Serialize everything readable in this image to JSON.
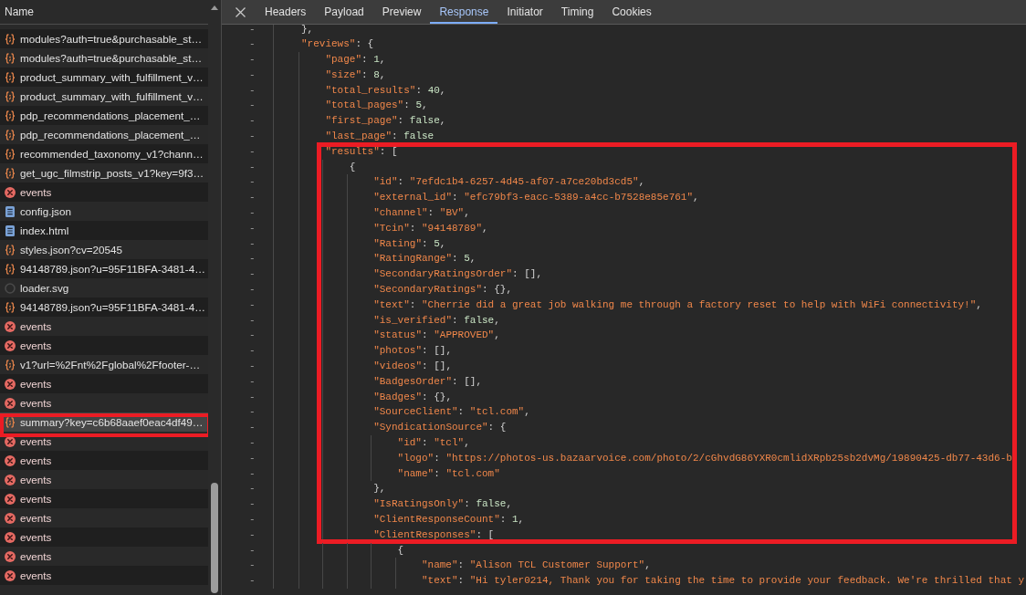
{
  "network_list": {
    "column": "Name",
    "requests": [
      {
        "name": "modules?auth=true&purchasable_st…",
        "kind": "fetch",
        "selected": false
      },
      {
        "name": "modules?auth=true&purchasable_st…",
        "kind": "fetch",
        "selected": false
      },
      {
        "name": "product_summary_with_fulfillment_v…",
        "kind": "fetch",
        "selected": false
      },
      {
        "name": "product_summary_with_fulfillment_v…",
        "kind": "fetch",
        "selected": false
      },
      {
        "name": "pdp_recommendations_placement_…",
        "kind": "fetch",
        "selected": false
      },
      {
        "name": "pdp_recommendations_placement_…",
        "kind": "fetch",
        "selected": false
      },
      {
        "name": "recommended_taxonomy_v1?chann…",
        "kind": "fetch",
        "selected": false
      },
      {
        "name": "get_ugc_filmstrip_posts_v1?key=9f3…",
        "kind": "fetch",
        "selected": false
      },
      {
        "name": "events",
        "kind": "error",
        "selected": false
      },
      {
        "name": "config.json",
        "kind": "document",
        "selected": false
      },
      {
        "name": "index.html",
        "kind": "document",
        "selected": false
      },
      {
        "name": "styles.json?cv=20545",
        "kind": "fetch",
        "selected": false
      },
      {
        "name": "94148789.json?u=95F11BFA-3481-4…",
        "kind": "fetch",
        "selected": false
      },
      {
        "name": "loader.svg",
        "kind": "image",
        "selected": false
      },
      {
        "name": "94148789.json?u=95F11BFA-3481-4…",
        "kind": "fetch",
        "selected": false
      },
      {
        "name": "events",
        "kind": "error",
        "selected": false
      },
      {
        "name": "events",
        "kind": "error",
        "selected": false
      },
      {
        "name": "v1?url=%2Fnt%2Fglobal%2Ffooter-…",
        "kind": "fetch",
        "selected": false
      },
      {
        "name": "events",
        "kind": "error",
        "selected": false
      },
      {
        "name": "events",
        "kind": "error",
        "selected": false
      },
      {
        "name": "summary?key=c6b68aaef0eac4df49…",
        "kind": "fetch",
        "selected": true,
        "framed": true
      },
      {
        "name": "events",
        "kind": "error",
        "selected": false
      },
      {
        "name": "events",
        "kind": "error",
        "selected": false
      },
      {
        "name": "events",
        "kind": "error",
        "selected": false
      },
      {
        "name": "events",
        "kind": "error",
        "selected": false
      },
      {
        "name": "events",
        "kind": "error",
        "selected": false
      },
      {
        "name": "events",
        "kind": "error",
        "selected": false
      },
      {
        "name": "events",
        "kind": "error",
        "selected": false
      },
      {
        "name": "events",
        "kind": "error",
        "selected": false
      }
    ]
  },
  "details": {
    "tabs": [
      {
        "label": "Headers",
        "selected": false
      },
      {
        "label": "Payload",
        "selected": false
      },
      {
        "label": "Preview",
        "selected": false
      },
      {
        "label": "Response",
        "selected": true
      },
      {
        "label": "Initiator",
        "selected": false
      },
      {
        "label": "Timing",
        "selected": false
      },
      {
        "label": "Cookies",
        "selected": false
      }
    ],
    "response": {
      "lines": [
        {
          "gutter": "-",
          "text": "},"
        },
        {
          "gutter": "-",
          "text": "\"reviews\": {",
          "children": [
            {
              "gutter": "-",
              "text": "\"page\": 1,"
            },
            {
              "gutter": "-",
              "text": "\"size\": 8,"
            },
            {
              "gutter": "-",
              "text": "\"total_results\": 40,"
            },
            {
              "gutter": "-",
              "text": "\"total_pages\": 5,"
            },
            {
              "gutter": "-",
              "text": "\"first_page\": false,"
            },
            {
              "gutter": "-",
              "text": "\"last_page\": false"
            },
            {
              "gutter": "-",
              "text": "\"results\": [",
              "framed": true,
              "children": [
                {
                  "gutter": "-",
                  "text": "{",
                  "framed": true,
                  "children": [
                    {
                      "gutter": "-",
                      "text": "\"id\": \"7efdc1b4-6257-4d45-af07-a7ce20bd3cd5\",",
                      "framed": true
                    },
                    {
                      "gutter": "-",
                      "text": "\"external_id\": \"efc79bf3-eacc-5389-a4cc-b7528e85e761\",",
                      "framed": true
                    },
                    {
                      "gutter": "-",
                      "text": "\"channel\": \"BV\",",
                      "framed": true
                    },
                    {
                      "gutter": "-",
                      "text": "\"Tcin\": \"94148789\",",
                      "framed": true
                    },
                    {
                      "gutter": "-",
                      "text": "\"Rating\": 5,",
                      "framed": true
                    },
                    {
                      "gutter": "-",
                      "text": "\"RatingRange\": 5,",
                      "framed": true
                    },
                    {
                      "gutter": "-",
                      "text": "\"SecondaryRatingsOrder\": [],",
                      "framed": true
                    },
                    {
                      "gutter": "-",
                      "text": "\"SecondaryRatings\": {},",
                      "framed": true
                    },
                    {
                      "gutter": "-",
                      "text": "\"text\": \"Cherrie did a great job walking me through a factory reset to help with WiFi connectivity!\",",
                      "framed": true
                    },
                    {
                      "gutter": "-",
                      "text": "\"is_verified\": false,",
                      "framed": true
                    },
                    {
                      "gutter": "-",
                      "text": "\"status\": \"APPROVED\",",
                      "framed": true
                    },
                    {
                      "gutter": "-",
                      "text": "\"photos\": [],",
                      "framed": true
                    },
                    {
                      "gutter": "-",
                      "text": "\"videos\": [],",
                      "framed": true
                    },
                    {
                      "gutter": "-",
                      "text": "\"BadgesOrder\": [],",
                      "framed": true
                    },
                    {
                      "gutter": "-",
                      "text": "\"Badges\": {},",
                      "framed": true
                    },
                    {
                      "gutter": "-",
                      "text": "\"SourceClient\": \"tcl.com\",",
                      "framed": true
                    },
                    {
                      "gutter": "-",
                      "text": "\"SyndicationSource\": {",
                      "framed": true,
                      "children": [
                        {
                          "gutter": "-",
                          "text": "\"id\": \"tcl\",",
                          "framed": true
                        },
                        {
                          "gutter": "-",
                          "text": "\"logo\": \"https://photos-us.bazaarvoice.com/photo/2/cGhvdG86YXR0cmlidXRpb25sb2dvMg/19890425-db77-43d6-b",
                          "framed": true
                        },
                        {
                          "gutter": "-",
                          "text": "\"name\": \"tcl.com\"",
                          "framed": true
                        }
                      ]
                    },
                    {
                      "gutter": "-",
                      "text": "},",
                      "framed": true
                    },
                    {
                      "gutter": "-",
                      "text": "\"IsRatingsOnly\": false,",
                      "framed": true
                    },
                    {
                      "gutter": "-",
                      "text": "\"ClientResponseCount\": 1,",
                      "framed": true
                    },
                    {
                      "gutter": "-",
                      "text": "\"ClientResponses\": [",
                      "framed": true,
                      "children": [
                        {
                          "gutter": "-",
                          "text": "{",
                          "children": [
                            {
                              "gutter": "-",
                              "text": "\"name\": \"Alison TCL Customer Support\","
                            },
                            {
                              "gutter": "-",
                              "text": "\"text\": \"Hi tyler0214, Thank you for taking the time to provide your feedback. We're thrilled that y"
                            }
                          ]
                        }
                      ]
                    }
                  ]
                }
              ]
            }
          ]
        }
      ]
    }
  }
}
